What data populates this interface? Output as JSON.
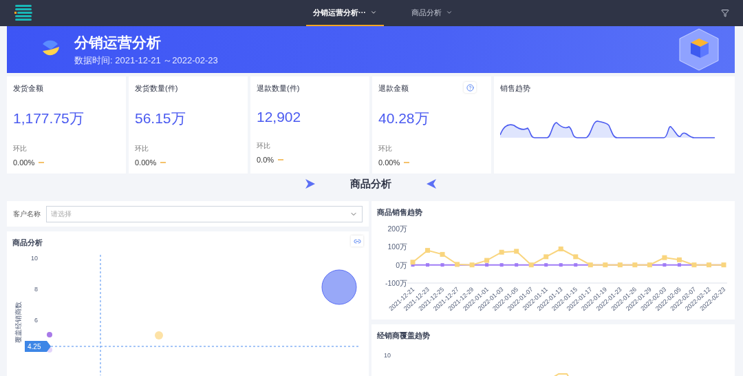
{
  "nav": {
    "tabs": [
      {
        "label": "分销运营分析···",
        "selected": true
      },
      {
        "label": "商品分析",
        "selected": false
      }
    ]
  },
  "banner": {
    "title": "分销运营分析",
    "subtitle": "数据时间:  2021-12-21 ～2022-02-23"
  },
  "kpis": [
    {
      "title": "发货金额",
      "value": "1,177.75万",
      "change_label": "环比",
      "change": "0.00%",
      "help": false
    },
    {
      "title": "发货数量(件)",
      "value": "56.15万",
      "change_label": "环比",
      "change": "0.00%",
      "help": false
    },
    {
      "title": "退款数量(件)",
      "value": "12,902",
      "change_label": "环比",
      "change": "0.0%",
      "help": false
    },
    {
      "title": "退款金额",
      "value": "40.28万",
      "change_label": "环比",
      "change": "0.00%",
      "help": true
    }
  ],
  "sales_trend": {
    "title": "销售趋势"
  },
  "section": {
    "title": "商品分析"
  },
  "filter": {
    "label": "客户名称",
    "placeholder": "请选择"
  },
  "bubble_chart": {
    "title": "商品分析",
    "y_axis_title": "覆盖经销商数",
    "y_ticks": [
      "10",
      "8",
      "6"
    ],
    "marker_label": "4.25"
  },
  "product_trend": {
    "title": "商品销售趋势",
    "chart_data": {
      "type": "line",
      "categories": [
        "2021-12-21",
        "2021-12-23",
        "2021-12-25",
        "2021-12-27",
        "2021-12-29",
        "2022-01-01",
        "2022-01-03",
        "2022-01-05",
        "2022-01-07",
        "2022-01-11",
        "2022-01-13",
        "2022-01-15",
        "2022-01-17",
        "2022-01-19",
        "2022-01-23",
        "2022-01-26",
        "2022-01-29",
        "2022-02-03",
        "2022-02-05",
        "2022-02-07",
        "2022-02-12",
        "2022-02-23"
      ],
      "series": [
        {
          "color": "#f9d57e",
          "marker": "square",
          "values": [
            15,
            80,
            58,
            3,
            0,
            25,
            70,
            75,
            0,
            45,
            88,
            45,
            0,
            0,
            0,
            0,
            0,
            40,
            28,
            0,
            0,
            0
          ]
        },
        {
          "color": "#a07cf6",
          "marker": "square",
          "values": [
            0,
            0,
            0,
            0,
            0,
            0,
            0,
            0,
            0,
            0,
            0,
            0,
            0,
            0,
            0,
            0,
            0,
            0,
            0,
            0,
            0,
            0
          ]
        }
      ],
      "ylim": [
        -100,
        200
      ],
      "yticks": [
        {
          "value": 200,
          "label": "200万"
        },
        {
          "value": 100,
          "label": "100万"
        },
        {
          "value": 0,
          "label": "0万"
        },
        {
          "value": -100,
          "label": "-100万"
        }
      ]
    }
  },
  "coverage_trend": {
    "title": "经销商覆盖趋势",
    "y_ticks": [
      "10"
    ]
  }
}
